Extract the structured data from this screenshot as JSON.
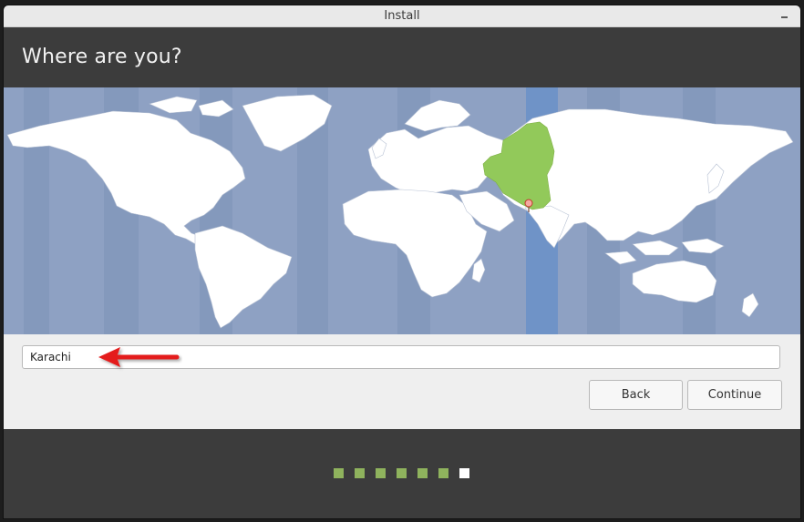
{
  "window": {
    "title": "Install"
  },
  "header": {
    "title": "Where are you?"
  },
  "map": {
    "selected_city": "Karachi",
    "highlight_color": "#92c95a",
    "ocean_color": "#8ea1c3",
    "land_color": "#ffffff",
    "selected_band_color": "#6f93c7"
  },
  "location": {
    "value": "Karachi"
  },
  "buttons": {
    "back": "Back",
    "continue": "Continue"
  },
  "progress": {
    "total_steps": 7,
    "current_step": 7,
    "done_color": "#8fb35d",
    "current_color": "#ffffff"
  }
}
